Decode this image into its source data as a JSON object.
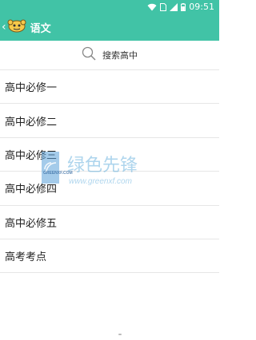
{
  "status_bar": {
    "time": "09:51",
    "icons": [
      "wifi-icon",
      "sim-card-icon",
      "signal-icon",
      "battery-icon"
    ]
  },
  "app_bar": {
    "title": "语文",
    "back_icon": "chevron-left-icon",
    "mascot_icon": "mascot-icon"
  },
  "search": {
    "label": "搜索高中",
    "icon": "search-icon"
  },
  "list": {
    "items": [
      {
        "label": "高中必修一"
      },
      {
        "label": "高中必修二"
      },
      {
        "label": "高中必修三"
      },
      {
        "label": "高中必修四"
      },
      {
        "label": "高中必修五"
      },
      {
        "label": "高考考点"
      }
    ]
  },
  "watermark": {
    "brand": "绿色先锋",
    "url": "www.greenxf.com",
    "badge": "GREENXF.COM"
  },
  "colors": {
    "accent": "#41c3a6",
    "divider": "#e6e6e6"
  }
}
